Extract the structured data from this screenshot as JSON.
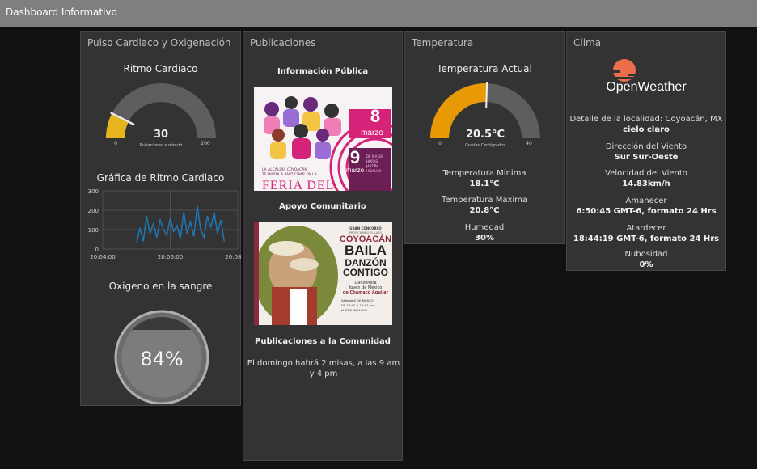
{
  "app": {
    "title": "Dashboard Informativo"
  },
  "pulse": {
    "panel_title": "Pulso Cardiaco y Oxigenación",
    "gauge": {
      "title": "Ritmo Cardiaco",
      "value": "30",
      "fraction": 0.15,
      "units": "Pulsaciones x minuto",
      "min": "0",
      "max": "200",
      "color": "#e6b51e"
    },
    "chart": {
      "title": "Gráfica de Ritmo Cardiaco",
      "y_ticks": [
        "300",
        "200",
        "100",
        "0"
      ],
      "x_ticks": [
        "20:04:00",
        "20:06:00",
        "20:08:00"
      ],
      "line_color": "#1f77b4"
    },
    "oxygen": {
      "title": "Oxigeno en la sangre",
      "value": "84%",
      "fraction": 0.84
    }
  },
  "chart_data": {
    "type": "line",
    "x": [
      "20:05:00",
      "20:05:06",
      "20:05:12",
      "20:05:18",
      "20:05:24",
      "20:05:30",
      "20:05:36",
      "20:05:42",
      "20:05:48",
      "20:05:54",
      "20:06:00",
      "20:06:06",
      "20:06:12",
      "20:06:18",
      "20:06:24",
      "20:06:30",
      "20:06:36",
      "20:06:42",
      "20:06:48",
      "20:06:54",
      "20:07:00",
      "20:07:06",
      "20:07:12",
      "20:07:18",
      "20:07:24",
      "20:07:30",
      "20:07:36"
    ],
    "series": [
      {
        "values": [
          30,
          110,
          40,
          170,
          80,
          130,
          60,
          150,
          100,
          70,
          160,
          90,
          120,
          55,
          190,
          80,
          140,
          65,
          225,
          100,
          60,
          170,
          110,
          190,
          80,
          150,
          40
        ]
      }
    ],
    "ylim": [
      0,
      300
    ],
    "xlim": [
      "20:04:00",
      "20:08:00"
    ],
    "grid": true
  },
  "publications": {
    "panel_title": "Publicaciones",
    "sections": [
      {
        "title": "Información Pública"
      },
      {
        "title": "Apoyo Comunitario"
      },
      {
        "title": "Publicaciones a la Comunidad"
      }
    ],
    "poster1": {
      "header": "LA ALCALDÍA COYOACÁN\nTE INVITA A PARTICIPAR EN LA",
      "big": "FERIA DEL",
      "day1": "8",
      "month1": "marzo",
      "day2": "9",
      "month2": "marzo",
      "side_lines": "DE 9 A 18 HORAS\nJARDÍN HIDALGO",
      "accent": "#d6237a"
    },
    "poster2": {
      "tag": "GRAN CONCURSO",
      "sub": "PROPICIANDO EL LAZO",
      "line1": "COYOACÁN",
      "line2": "BAILA",
      "line3": "DANZÓN",
      "line4": "CONTIGO",
      "caption1": "Danzonera",
      "caption2": "Joven de México",
      "caption3": "de Chamaco Aguilar",
      "date": "Sábado 6 DE MARZO",
      "time": "DE 13:00 A 18:00 hrs",
      "place": "JARDÍN HIDALGO",
      "accent": "#8a2b3e"
    },
    "community_text": "El domingo habrá 2 misas, a las 9 am y 4 pm"
  },
  "temperature": {
    "panel_title": "Temperatura",
    "gauge": {
      "title": "Temperatura Actual",
      "value": "20.5°C",
      "fraction": 0.51,
      "units": "Grados Centígrados",
      "min": "0",
      "max": "40",
      "color": "#e89a06"
    },
    "min_label": "Temperatura Mínima",
    "min_value": "18.1°C",
    "max_label": "Temperatura Máxima",
    "max_value": "20.8°C",
    "humidity_label": "Humedad",
    "humidity_value": "30%"
  },
  "weather": {
    "panel_title": "Clima",
    "logo_text": "OpenWeather",
    "logo_color": "#eb6e4b",
    "location_label": "Detalle de la localidad: Coyoacán, MX",
    "description": "cielo claro",
    "wind_dir_label": "Dirección del Viento",
    "wind_dir_value": "Sur Sur-Oeste",
    "wind_speed_label": "Velocidad del Viento",
    "wind_speed_value": "14.83km/h",
    "sunrise_label": "Amanecer",
    "sunrise_value": "6:50:45 GMT-6, formato 24 Hrs",
    "sunset_label": "Atardecer",
    "sunset_value": "18:44:19 GMT-6, formato 24 Hrs",
    "clouds_label": "Nubosidad",
    "clouds_value": "0%"
  }
}
